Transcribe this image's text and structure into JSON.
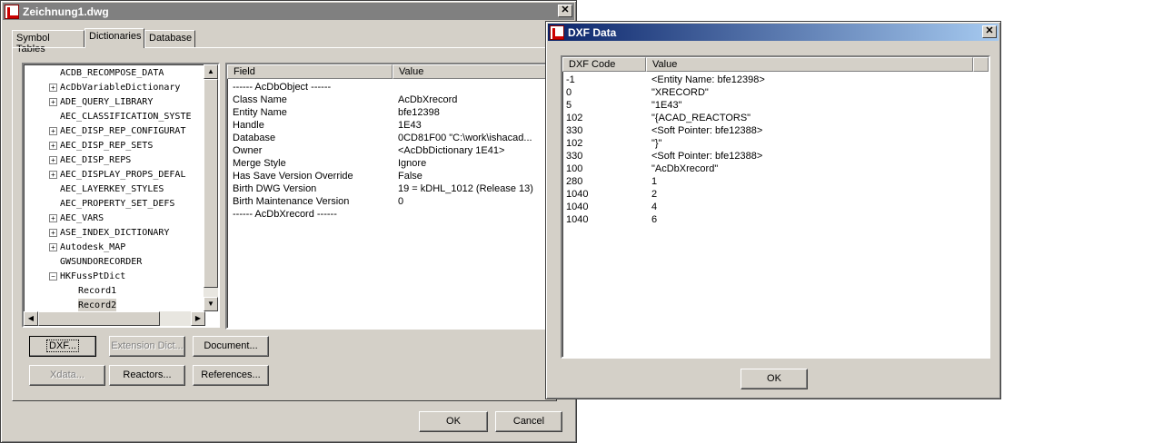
{
  "main_window": {
    "title": "Zeichnung1.dwg",
    "tabs": [
      "Symbol Tables",
      "Dictionaries",
      "Database"
    ],
    "active_tab": 1,
    "tree": [
      {
        "label": "ACDB_RECOMPOSE_DATA",
        "expandable": false
      },
      {
        "label": "AcDbVariableDictionary",
        "expandable": true
      },
      {
        "label": "ADE_QUERY_LIBRARY",
        "expandable": true
      },
      {
        "label": "AEC_CLASSIFICATION_SYSTE",
        "expandable": false
      },
      {
        "label": "AEC_DISP_REP_CONFIGURAT",
        "expandable": true
      },
      {
        "label": "AEC_DISP_REP_SETS",
        "expandable": true
      },
      {
        "label": "AEC_DISP_REPS",
        "expandable": true
      },
      {
        "label": "AEC_DISPLAY_PROPS_DEFAL",
        "expandable": true
      },
      {
        "label": "AEC_LAYERKEY_STYLES",
        "expandable": false
      },
      {
        "label": "AEC_PROPERTY_SET_DEFS",
        "expandable": false
      },
      {
        "label": "AEC_VARS",
        "expandable": true
      },
      {
        "label": "ASE_INDEX_DICTIONARY",
        "expandable": true
      },
      {
        "label": "Autodesk_MAP",
        "expandable": true
      },
      {
        "label": "GWSUNDORECORDER",
        "expandable": false
      },
      {
        "label": "HKFussPtDict",
        "expandable": true,
        "expanded": true
      },
      {
        "label": "Record1",
        "expandable": false,
        "child": true
      },
      {
        "label": "Record2",
        "expandable": false,
        "child": true,
        "selected": true
      }
    ],
    "list_headers": {
      "field": "Field",
      "value": "Value"
    },
    "rows": [
      {
        "field": "------ AcDbObject ------",
        "value": ""
      },
      {
        "field": "Class Name",
        "value": "AcDbXrecord"
      },
      {
        "field": "Entity Name",
        "value": "bfe12398"
      },
      {
        "field": "Handle",
        "value": "1E43"
      },
      {
        "field": "Database",
        "value": "0CD81F00  \"C:\\work\\ishacad..."
      },
      {
        "field": "Owner",
        "value": "<AcDbDictionary       1E41>"
      },
      {
        "field": "Merge Style",
        "value": "Ignore"
      },
      {
        "field": "Has Save Version Override",
        "value": "False"
      },
      {
        "field": "Birth DWG Version",
        "value": "19 = kDHL_1012  (Release 13)"
      },
      {
        "field": "Birth Maintenance Version",
        "value": "0"
      },
      {
        "field": "------ AcDbXrecord ------",
        "value": ""
      }
    ],
    "buttons": {
      "dxf": "DXF...",
      "extension_dict": "Extension Dict...",
      "document": "Document...",
      "xdata": "Xdata...",
      "reactors": "Reactors...",
      "references": "References...",
      "ok": "OK",
      "cancel": "Cancel"
    }
  },
  "dxf_window": {
    "title": "DXF Data",
    "headers": {
      "code": "DXF Code",
      "value": "Value"
    },
    "rows": [
      {
        "code": "-1",
        "value": "<Entity Name: bfe12398>"
      },
      {
        "code": "0",
        "value": "\"XRECORD\""
      },
      {
        "code": "5",
        "value": "\"1E43\""
      },
      {
        "code": "102",
        "value": "\"{ACAD_REACTORS\""
      },
      {
        "code": "330",
        "value": "<Soft Pointer: bfe12388>"
      },
      {
        "code": "102",
        "value": "\"}\""
      },
      {
        "code": "330",
        "value": "<Soft Pointer: bfe12388>"
      },
      {
        "code": "100",
        "value": "\"AcDbXrecord\""
      },
      {
        "code": "280",
        "value": "1"
      },
      {
        "code": "1040",
        "value": "2"
      },
      {
        "code": "1040",
        "value": "4"
      },
      {
        "code": "1040",
        "value": "6"
      }
    ],
    "ok": "OK"
  }
}
